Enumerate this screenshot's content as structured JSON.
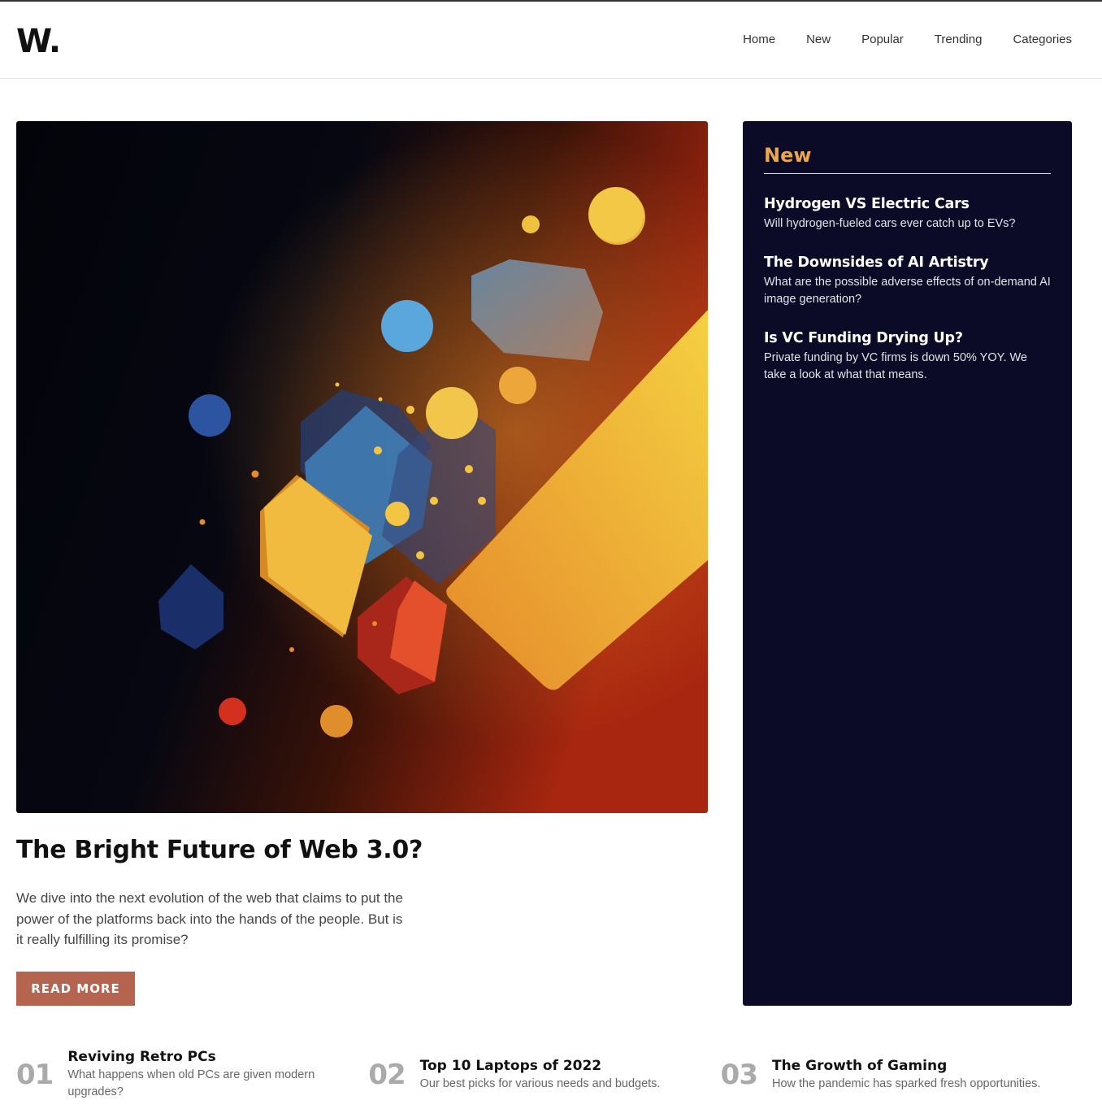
{
  "header": {
    "logo": "W.",
    "nav": [
      "Home",
      "New",
      "Popular",
      "Trending",
      "Categories"
    ]
  },
  "hero": {
    "title": "The Bright Future of Web 3.0?",
    "description": "We dive into the next evolution of the web that claims to put the power of the platforms back into the hands of the people. But is it really fulfilling its promise?",
    "button_label": "READ MORE"
  },
  "sidebar": {
    "title": "New",
    "items": [
      {
        "title": "Hydrogen VS Electric Cars",
        "desc": "Will hydrogen-fueled cars ever catch up to EVs?"
      },
      {
        "title": "The Downsides of AI Artistry",
        "desc": "What are the possible adverse effects of on-demand AI image generation?"
      },
      {
        "title": "Is VC Funding Drying Up?",
        "desc": "Private funding by VC firms is down 50% YOY. We take a look at what that means."
      }
    ]
  },
  "bottom": [
    {
      "num": "01",
      "title": "Reviving Retro PCs",
      "desc": "What happens when old PCs are given modern upgrades?"
    },
    {
      "num": "02",
      "title": "Top 10 Laptops of 2022",
      "desc": "Our best picks for various needs and budgets."
    },
    {
      "num": "03",
      "title": "The Growth of Gaming",
      "desc": "How the pandemic has sparked fresh opportunities."
    }
  ],
  "colors": {
    "accent": "#b5654f",
    "sidebar_bg": "#0c0b27",
    "sidebar_heading": "#e9a74e"
  }
}
